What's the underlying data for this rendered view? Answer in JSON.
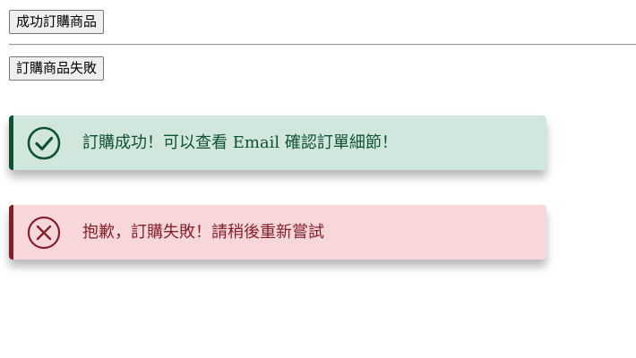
{
  "buttons": {
    "success_label": "成功訂購商品",
    "fail_label": "訂購商品失敗"
  },
  "toasts": {
    "success": {
      "message": "訂購成功！可以查看 Email 確認訂單細節！",
      "icon": "check-circle-icon",
      "text_color": "#0f5133",
      "background": "#d1e6dd"
    },
    "error": {
      "message": "抱歉，訂購失敗！請稍後重新嘗試",
      "icon": "x-circle-icon",
      "text_color": "#842029",
      "background": "#f8d7da"
    }
  }
}
